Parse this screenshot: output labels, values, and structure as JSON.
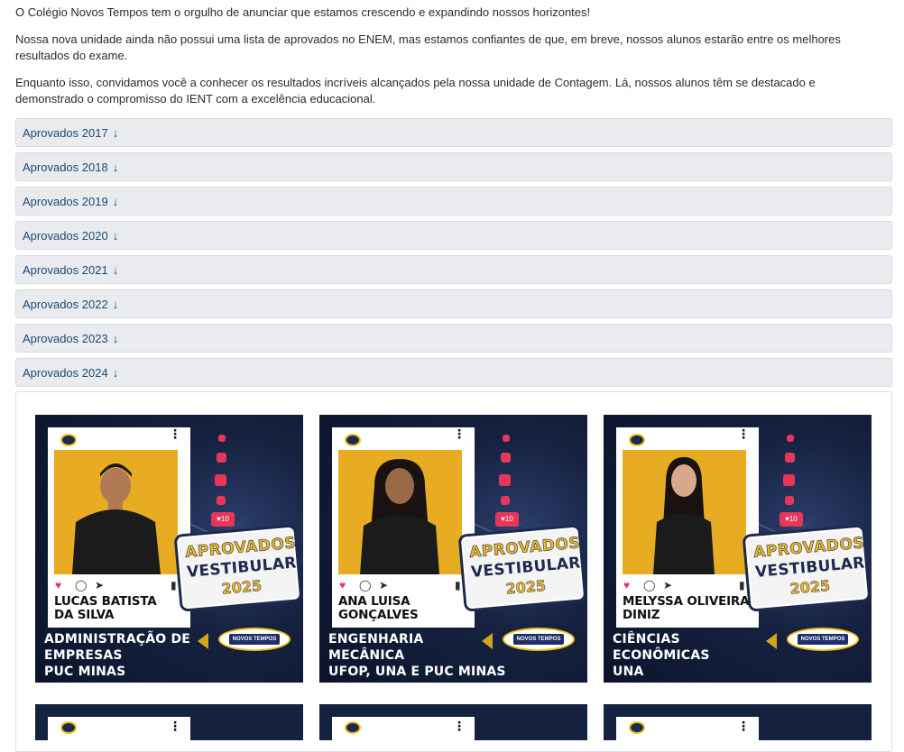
{
  "intro": {
    "p1": "O Colégio Novos Tempos tem o orgulho de anunciar que estamos crescendo e expandindo nossos horizontes!",
    "p2": "Nossa nova unidade ainda não possui uma lista de aprovados no ENEM, mas estamos confiantes de que, em breve, nossos alunos estarão entre os melhores resultados do exame.",
    "p3": "Enquanto isso, convidamos você a conhecer os resultados incríveis alcançados pela nossa unidade de Contagem. Lá, nossos alunos têm se destacado e demonstrado o compromisso do IENT com a excelência educacional."
  },
  "accordion": {
    "items": [
      {
        "label": "Aprovados 2017",
        "arrow": "↓"
      },
      {
        "label": "Aprovados 2018",
        "arrow": "↓"
      },
      {
        "label": "Aprovados 2019",
        "arrow": "↓"
      },
      {
        "label": "Aprovados 2020",
        "arrow": "↓"
      },
      {
        "label": "Aprovados 2021",
        "arrow": "↓"
      },
      {
        "label": "Aprovados 2022",
        "arrow": "↓"
      },
      {
        "label": "Aprovados 2023",
        "arrow": "↓"
      },
      {
        "label": "Aprovados 2024",
        "arrow": "↓"
      }
    ]
  },
  "badge": {
    "line1": "APROVADOS",
    "line2": "VESTIBULAR",
    "line3": "2025",
    "likes": "10",
    "brand": "NOVOS TEMPOS"
  },
  "cards": [
    {
      "name_line1": "LUCAS BATISTA",
      "name_line2": "DA SILVA",
      "course_line1": "ADMINISTRAÇÃO DE",
      "course_line2": "EMPRESAS",
      "course_line3": "PUC MINAS"
    },
    {
      "name_line1": "ANA LUISA",
      "name_line2": "GONÇALVES",
      "course_line1": "ENGENHARIA",
      "course_line2": "MECÂNICA",
      "course_line3": "UFOP, UNA E PUC MINAS"
    },
    {
      "name_line1": "MELYSSA OLIVEIRA",
      "name_line2": "DINIZ",
      "course_line1": "CIÊNCIAS",
      "course_line2": "ECONÔMICAS",
      "course_line3": "UNA"
    }
  ],
  "icons": {
    "heart": "heart-icon",
    "comment": "comment-icon",
    "share": "share-icon",
    "bookmark": "bookmark-icon",
    "more": "more-icon"
  },
  "colors": {
    "accordion_bg": "#e9ebee",
    "accordion_text": "#1c4a78",
    "card_bg": "#15213f",
    "accent_yellow": "#e7ac22",
    "heart_red": "#e8365a"
  }
}
